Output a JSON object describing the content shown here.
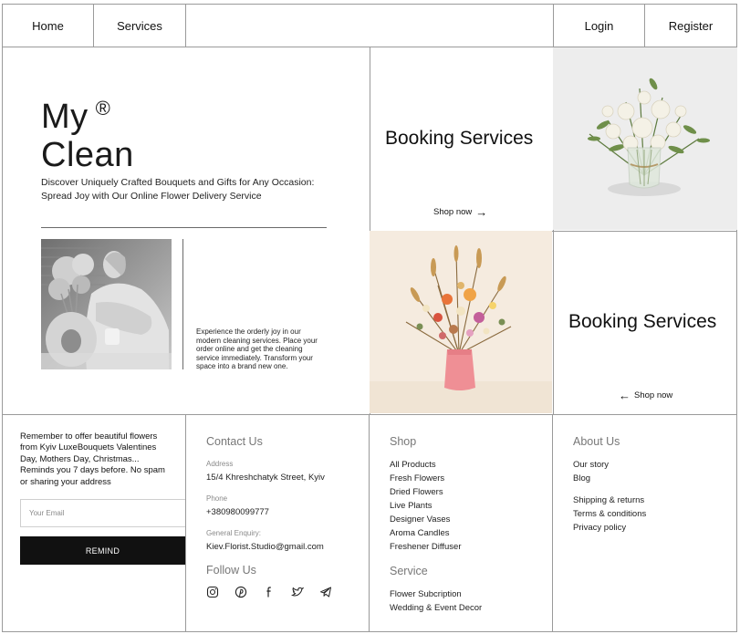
{
  "nav": {
    "home": "Home",
    "services": "Services",
    "login": "Login",
    "register": "Register"
  },
  "hero": {
    "title_line1": "My",
    "registered_mark": "®",
    "title_line2": "Clean",
    "subtitle": "Discover Uniquely Crafted Bouquets and Gifts for Any Occasion: Spread Joy with Our Online Flower Delivery Service",
    "description": "Experience the orderly joy in our modern cleaning services. Place your order online and get the cleaning service immediately. Transform your space into a brand new one."
  },
  "tiles": {
    "top": {
      "title": "Booking Services",
      "link": "Shop now",
      "arrow": "→"
    },
    "bottom": {
      "title": "Booking Services",
      "link": "Shop now",
      "arrow": "←"
    }
  },
  "newsletter": {
    "text": "Remember to offer beautiful flowers from Kyiv LuxeBouquets Valentines Day, Mothers Day, Christmas... Reminds you 7 days before. No spam or sharing your address",
    "email_placeholder": "Your Email",
    "button": "REMIND"
  },
  "contact": {
    "heading": "Contact Us",
    "address_label": "Address",
    "address": "15/4 Khreshchatyk Street, Kyiv",
    "phone_label": "Phone",
    "phone": "+380980099777",
    "enquiry_label": "General Enquiry:",
    "email": "Kiev.Florist.Studio@gmail.com",
    "follow_heading": "Follow Us",
    "socials": [
      "instagram-icon",
      "pinterest-icon",
      "facebook-icon",
      "twitter-icon",
      "telegram-icon"
    ]
  },
  "shop": {
    "heading": "Shop",
    "items": [
      "All Products",
      "Fresh Flowers",
      "Dried Flowers",
      "Live Plants",
      "Designer Vases",
      "Aroma Candles",
      "Freshener Diffuser"
    ],
    "service_heading": "Service",
    "service_items": [
      "Flower Subcription",
      "Wedding & Event Decor"
    ]
  },
  "about": {
    "heading": "About Us",
    "items": [
      "Our story",
      "Blog"
    ],
    "legal_items": [
      "Shipping & returns",
      "Terms & conditions",
      "Privacy policy"
    ]
  },
  "colors": {
    "border": "#9a9a9a",
    "button_bg": "#111111",
    "heading_gray": "#777777",
    "bouquet_bg": "#f5ede3",
    "vase_pink": "#ef8f95"
  }
}
